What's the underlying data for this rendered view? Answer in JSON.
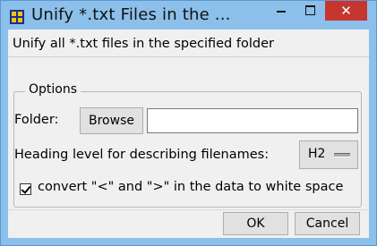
{
  "window": {
    "title": "Unify *.txt Files in the ...",
    "close_glyph": "✕"
  },
  "dialog": {
    "description": "Unify all *.txt files in the specified folder",
    "options_legend": "Options",
    "folder_label": "Folder:",
    "browse_label": "Browse",
    "folder_value": "",
    "heading_label": "Heading level for describing filenames:",
    "heading_value": "H2",
    "convert_label": "convert \"<\" and \">\" in the data to white space",
    "convert_checked": true,
    "ok_label": "OK",
    "cancel_label": "Cancel"
  },
  "icons": [
    "app-icon",
    "minimize-icon",
    "maximize-icon",
    "close-icon",
    "check-icon",
    "dropdown-icon"
  ],
  "colors": {
    "titlebar": "#8cc0ea",
    "close_button": "#c7352f",
    "client_bg": "#f0f0f0"
  }
}
